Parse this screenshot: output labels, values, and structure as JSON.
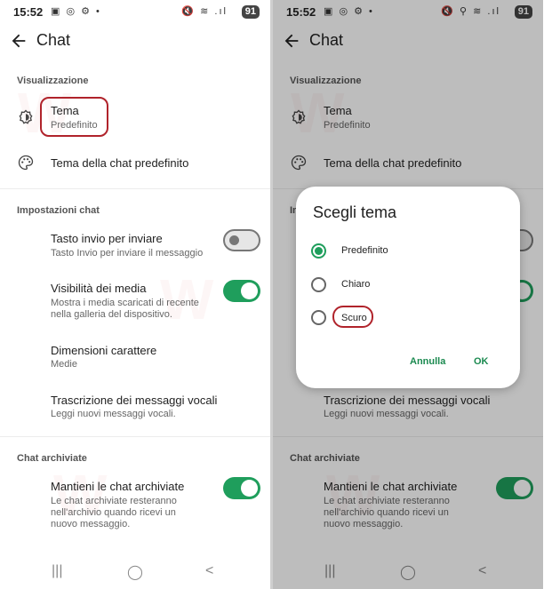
{
  "status_bar": {
    "time": "15:52",
    "left_icons": "▣ ◎ ⚙ •",
    "right_icons_left": "🔇 ≋ .ıl",
    "right_icons_right": "🔇 ⚲ ≋ .ıl",
    "battery": "91"
  },
  "app_bar": {
    "title": "Chat"
  },
  "sections": {
    "display": "Visualizzazione",
    "chat_settings": "Impostazioni chat",
    "archived": "Chat archiviate"
  },
  "items": {
    "theme": {
      "title": "Tema",
      "subtitle": "Predefinito"
    },
    "wallpaper": {
      "title": "Tema della chat predefinito"
    },
    "enter_send": {
      "title": "Tasto invio per inviare",
      "subtitle": "Tasto Invio per inviare il messaggio",
      "enabled": false
    },
    "media_visibility": {
      "title": "Visibilità dei media",
      "subtitle_line1": "Mostra i media scaricati di recente",
      "subtitle_line2": "nella galleria del dispositivo.",
      "enabled": true
    },
    "font_size": {
      "title": "Dimensioni carattere",
      "subtitle": "Medie"
    },
    "voice_transcription": {
      "title": "Trascrizione dei messaggi vocali",
      "subtitle": "Leggi nuovi messaggi vocali."
    },
    "keep_archived": {
      "title": "Mantieni le chat archiviate",
      "subtitle_line1": "Le chat archiviate resteranno",
      "subtitle_line2": "nell'archivio quando ricevi un",
      "subtitle_line3": "nuovo messaggio.",
      "enabled": true
    }
  },
  "dialog": {
    "title": "Scegli tema",
    "options": [
      {
        "label": "Predefinito",
        "selected": true
      },
      {
        "label": "Chiaro",
        "selected": false
      },
      {
        "label": "Scuro",
        "selected": false
      }
    ],
    "cancel_label": "Annulla",
    "ok_label": "OK"
  },
  "nav_bar": {
    "recents": "|||",
    "home": "◯",
    "back": "<"
  },
  "watermark_text": "W",
  "colors": {
    "accent": "#1f9e5c",
    "highlight": "#b0232b",
    "dialog_button": "#1b8a50"
  }
}
